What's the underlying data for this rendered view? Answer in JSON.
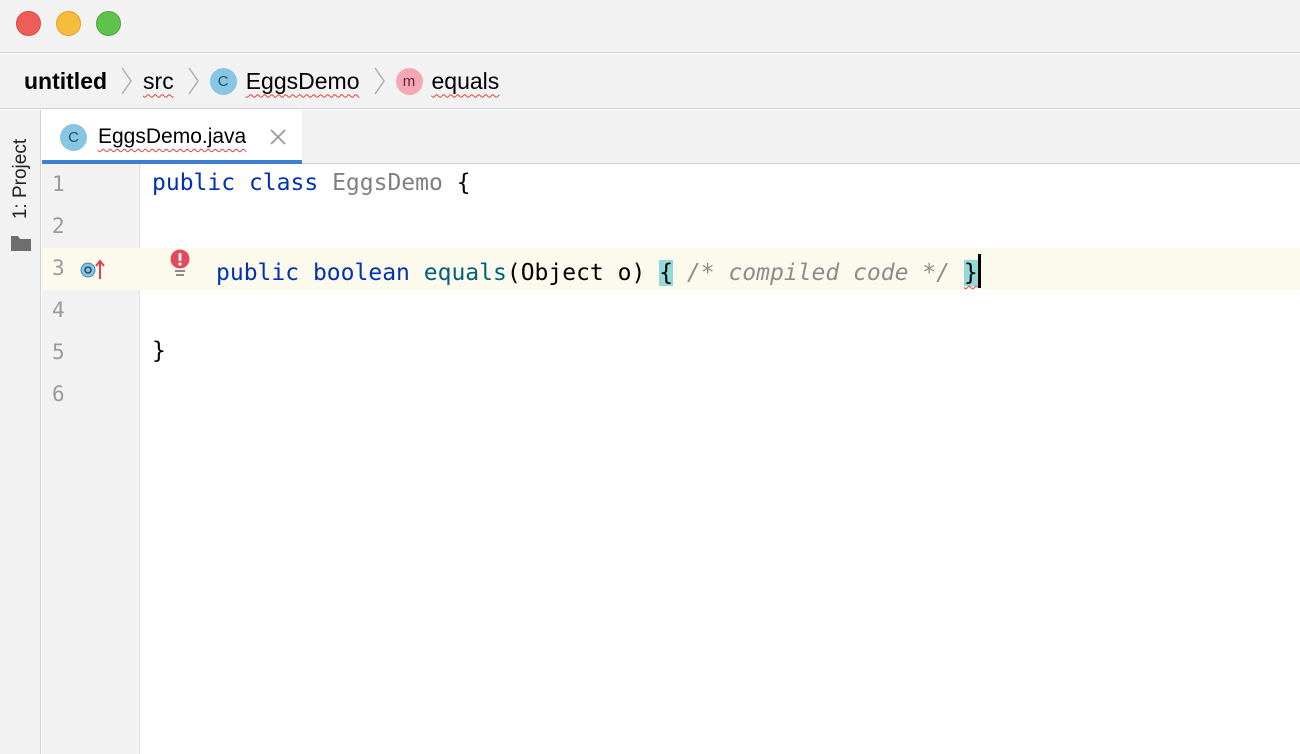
{
  "window": {
    "controls": [
      "close",
      "minimize",
      "zoom"
    ]
  },
  "breadcrumb": {
    "project": "untitled",
    "folder": "src",
    "class_badge": "C",
    "class_name": "EggsDemo",
    "method_badge": "m",
    "method_name": "equals"
  },
  "toolstrip": {
    "project_label": "1: Project"
  },
  "tabs": [
    {
      "badge": "C",
      "label": "EggsDemo.java",
      "active": true
    }
  ],
  "editor": {
    "line_numbers": [
      "1",
      "2",
      "3",
      "4",
      "5",
      "6"
    ],
    "current_line": 3,
    "code": {
      "l1_kw_public": "public",
      "l1_kw_class": "class",
      "l1_classname": "EggsDemo",
      "l1_brace": "{",
      "l3_kw_public": "public",
      "l3_kw_boolean": "boolean",
      "l3_method": "equals",
      "l3_params": "(Object o)",
      "l3_open_brace": "{",
      "l3_comment": "/* compiled code */",
      "l3_close_brace": "}",
      "l5_brace": "}"
    }
  },
  "colors": {
    "keyword": "#0033b3",
    "method": "#00627a",
    "comment": "#8c8c8c",
    "brace_highlight": "#93d9d9",
    "active_tab_underline": "#3d7fd0",
    "error": "#e04050"
  },
  "icons": {
    "gutter_line3": "override-method-icon",
    "intention": "error-bulb-icon",
    "folder": "folder-icon",
    "tab_close": "close-icon"
  }
}
